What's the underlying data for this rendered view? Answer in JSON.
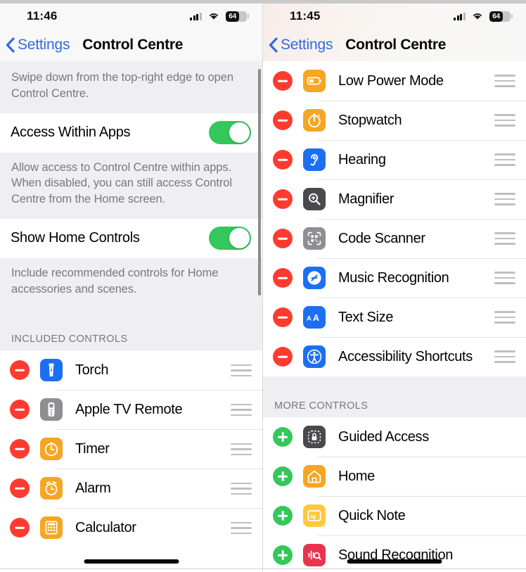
{
  "left_screen": {
    "status": {
      "time": "11:46",
      "battery_level": "64",
      "battery_percent": 64,
      "cellular_icon": "cellular-bars-icon",
      "wifi_icon": "wifi-icon",
      "battery_icon": "battery-icon"
    },
    "nav": {
      "back_label": "Settings",
      "back_icon": "chevron-left-icon",
      "title": "Control Centre"
    },
    "footnote_top": "Swipe down from the top-right edge to open Control Centre.",
    "toggles": [
      {
        "label": "Access Within Apps",
        "on": true,
        "footnote": "Allow access to Control Centre within apps. When disabled, you can still access Control Centre from the Home screen."
      },
      {
        "label": "Show Home Controls",
        "on": true,
        "footnote": "Include recommended controls for Home accessories and scenes."
      }
    ],
    "section_title": "INCLUDED CONTROLS",
    "controls": [
      {
        "label": "Torch",
        "action": "remove",
        "icon": "torch-icon",
        "icon_bg": "#1d6ff2"
      },
      {
        "label": "Apple TV Remote",
        "action": "remove",
        "icon": "apple-tv-remote-icon",
        "icon_bg": "#8e8e93"
      },
      {
        "label": "Timer",
        "action": "remove",
        "icon": "timer-icon",
        "icon_bg": "#f5a623"
      },
      {
        "label": "Alarm",
        "action": "remove",
        "icon": "alarm-icon",
        "icon_bg": "#f5a623"
      },
      {
        "label": "Calculator",
        "action": "remove",
        "icon": "calculator-icon",
        "icon_bg": "#f5a623"
      }
    ]
  },
  "right_screen": {
    "status": {
      "time": "11:45",
      "battery_level": "64",
      "battery_percent": 64,
      "cellular_icon": "cellular-bars-icon",
      "wifi_icon": "wifi-icon",
      "battery_icon": "battery-icon"
    },
    "nav": {
      "back_label": "Settings",
      "back_icon": "chevron-left-icon",
      "title": "Control Centre"
    },
    "included_controls": [
      {
        "label": "Low Power Mode",
        "action": "remove",
        "icon": "low-power-mode-icon",
        "icon_bg": "#f5a623"
      },
      {
        "label": "Stopwatch",
        "action": "remove",
        "icon": "stopwatch-icon",
        "icon_bg": "#f5a623"
      },
      {
        "label": "Hearing",
        "action": "remove",
        "icon": "hearing-icon",
        "icon_bg": "#1d6ff2"
      },
      {
        "label": "Magnifier",
        "action": "remove",
        "icon": "magnifier-icon",
        "icon_bg": "#4a4a4d"
      },
      {
        "label": "Code Scanner",
        "action": "remove",
        "icon": "code-scanner-icon",
        "icon_bg": "#8e8e93"
      },
      {
        "label": "Music Recognition",
        "action": "remove",
        "icon": "shazam-icon",
        "icon_bg": "#1d6ff2"
      },
      {
        "label": "Text Size",
        "action": "remove",
        "icon": "text-size-icon",
        "icon_bg": "#1d6ff2"
      },
      {
        "label": "Accessibility Shortcuts",
        "action": "remove",
        "icon": "accessibility-icon",
        "icon_bg": "#1d6ff2"
      }
    ],
    "section_title": "MORE CONTROLS",
    "more_controls": [
      {
        "label": "Guided Access",
        "action": "add",
        "icon": "guided-access-icon",
        "icon_bg": "#4a4a4d"
      },
      {
        "label": "Home",
        "action": "add",
        "icon": "home-icon",
        "icon_bg": "#f5a623"
      },
      {
        "label": "Quick Note",
        "action": "add",
        "icon": "quick-note-icon",
        "icon_bg": "#ffc93c"
      },
      {
        "label": "Sound Recognition",
        "action": "add",
        "icon": "sound-recognition-icon",
        "icon_bg": "#e8344e"
      }
    ]
  },
  "colors": {
    "accent_blue": "#2f6be0",
    "toggle_green": "#34c759",
    "remove_red": "#ff3b30",
    "add_green": "#34c759",
    "group_background": "#efeef3",
    "secondary_text": "#78787e"
  }
}
